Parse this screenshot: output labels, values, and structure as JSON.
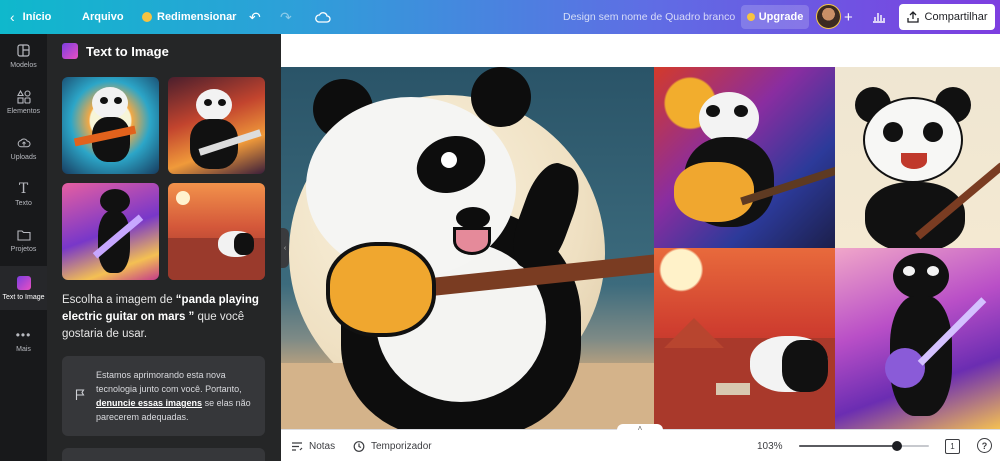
{
  "topbar": {
    "back_label": "Início",
    "file_label": "Arquivo",
    "resize_label": "Redimensionar",
    "design_name": "Design sem nome de Quadro branco",
    "upgrade_label": "Upgrade",
    "share_label": "Compartilhar"
  },
  "rail": {
    "items": [
      {
        "label": "Modelos",
        "icon": "templates-icon"
      },
      {
        "label": "Elementos",
        "icon": "elements-icon"
      },
      {
        "label": "Uploads",
        "icon": "upload-cloud-icon"
      },
      {
        "label": "Texto",
        "icon": "text-icon"
      },
      {
        "label": "Projetos",
        "icon": "folder-icon"
      },
      {
        "label": "Text to Image",
        "icon": "text-to-image-icon"
      },
      {
        "label": "Mais",
        "icon": "more-dots-icon"
      }
    ],
    "active_index": 5
  },
  "panel": {
    "title": "Text to Image",
    "desc_prefix": "Escolha a imagem de ",
    "desc_prompt": "“panda playing electric guitar on mars ”",
    "desc_suffix": " que você gostaria de usar.",
    "notice_prefix": "Estamos aprimorando esta nova tecnologia junto com você. Portanto, ",
    "notice_link": "denuncie essas imagens",
    "notice_suffix": " se elas não parecerem adequadas."
  },
  "bottombar": {
    "notes_label": "Notas",
    "timer_label": "Temporizador",
    "zoom_label": "103%",
    "zoom_slider_fraction": 0.75,
    "page_number": "1",
    "help_label": "?"
  },
  "colors": {
    "topbar_start": "#0fb8cc",
    "topbar_end": "#7d3ee0",
    "panel_bg": "#252627",
    "rail_bg": "#18191b"
  }
}
